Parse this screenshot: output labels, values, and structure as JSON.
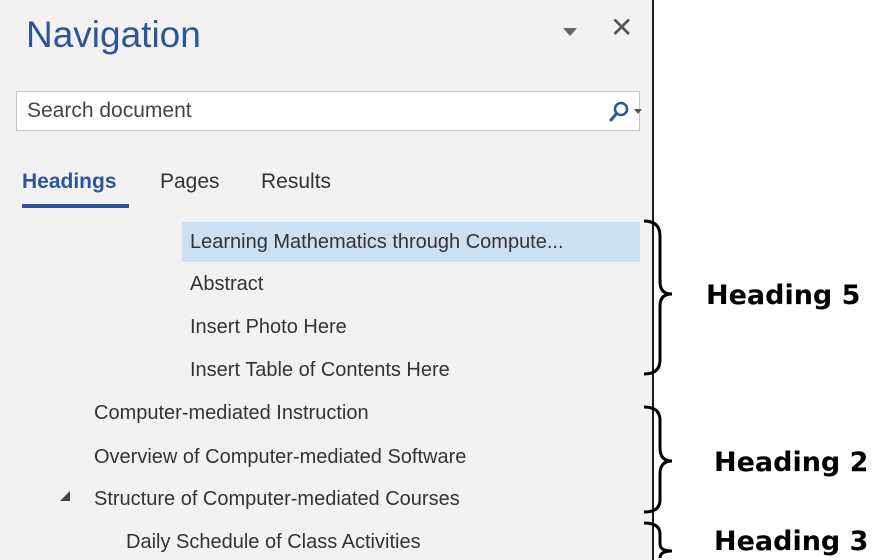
{
  "panel": {
    "title": "Navigation",
    "search_placeholder": "Search document",
    "tabs": [
      {
        "label": "Headings",
        "active": true
      },
      {
        "label": "Pages",
        "active": false
      },
      {
        "label": "Results",
        "active": false
      }
    ],
    "headings": [
      {
        "label": "Learning Mathematics through Compute...",
        "selected": true
      },
      {
        "label": "Abstract"
      },
      {
        "label": "Insert Photo Here"
      },
      {
        "label": "Insert Table of Contents Here"
      },
      {
        "label": "Computer-mediated Instruction"
      },
      {
        "label": "Overview of Computer-mediated Software"
      },
      {
        "label": "Structure of Computer-mediated Courses",
        "expanded": true
      },
      {
        "label": "Daily Schedule of Class Activities"
      }
    ]
  },
  "annotations": [
    {
      "label": "Heading 5"
    },
    {
      "label": "Heading 2"
    },
    {
      "label": "Heading 3"
    }
  ],
  "colors": {
    "accent": "#2b579a",
    "selection": "#cce0f4",
    "pane_bg": "#f2f2f2"
  }
}
